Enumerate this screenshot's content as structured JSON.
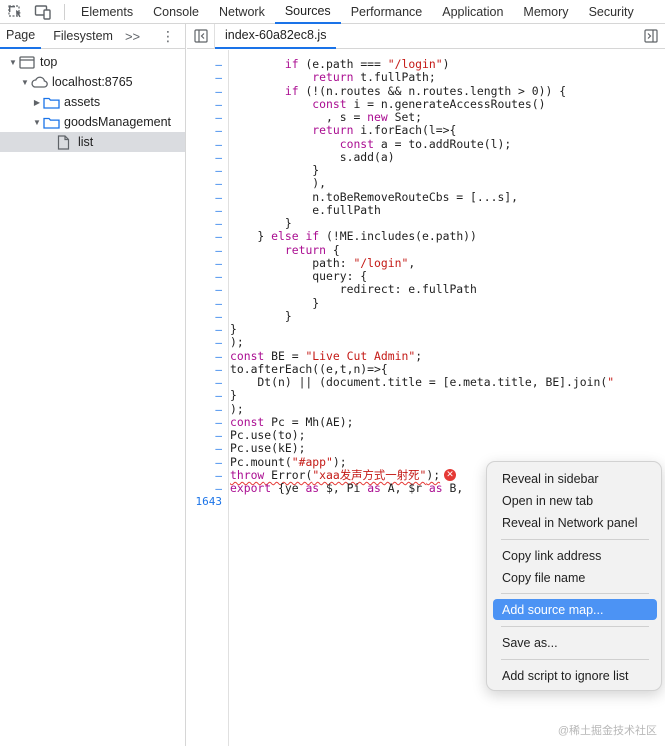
{
  "topbar": {
    "tabs": [
      "Elements",
      "Console",
      "Network",
      "Sources",
      "Performance",
      "Application",
      "Memory",
      "Security"
    ],
    "active_tab": "Sources"
  },
  "navigator": {
    "tabs": [
      "Page",
      "Filesystem"
    ],
    "more": ">>",
    "kebab": "⋮",
    "tree": [
      "top",
      "localhost:8765",
      "assets",
      "goodsManagement",
      "list"
    ]
  },
  "editor": {
    "file_tab": "index-60a82ec8.js",
    "line_marker": "–",
    "last_line_number": "1643",
    "code_lines": [
      "        if (e.path === \"/login\")",
      "            return t.fullPath;",
      "        if (!(n.routes && n.routes.length > 0)) {",
      "            const i = n.generateAccessRoutes()",
      "              , s = new Set;",
      "            return i.forEach(l=>{",
      "                const a = to.addRoute(l);",
      "                s.add(a)",
      "            }",
      "            ),",
      "            n.toBeRemoveRouteCbs = [...s],",
      "            e.fullPath",
      "        }",
      "    } else if (!ME.includes(e.path))",
      "        return {",
      "            path: \"/login\",",
      "            query: {",
      "                redirect: e.fullPath",
      "            }",
      "        }",
      "}",
      ");",
      "const BE = \"Live Cut Admin\";",
      "to.afterEach((e,t,n)=>{",
      "    Dt(n) || (document.title = [e.meta.title, BE].join(\"",
      "}",
      ");",
      "const Pc = Mh(AE);",
      "Pc.use(to);",
      "Pc.use(kE);",
      "Pc.mount(\"#app\");",
      "throw Error(\"xaa发声方式一射死\");",
      "export {ye as $, Pi as A, $r as B,"
    ],
    "error_icon": "✕"
  },
  "context_menu": {
    "items": [
      "Reveal in sidebar",
      "Open in new tab",
      "Reveal in Network panel",
      "Copy link address",
      "Copy file name",
      "Add source map...",
      "Save as...",
      "Add script to ignore list"
    ],
    "highlighted": "Add source map..."
  },
  "watermark": "@稀土掘金技术社区"
}
